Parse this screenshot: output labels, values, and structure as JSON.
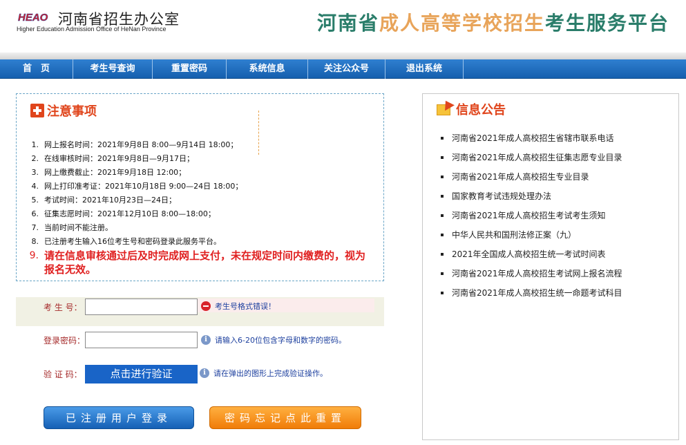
{
  "header": {
    "logo_mark": "HEAO",
    "logo_cn": "河南省招生办公室",
    "logo_en": "Higher Education Admission Office of HeNan Province",
    "title_part1": "河南省",
    "title_part2": "成人高等学校招生",
    "title_part3": "考生服务平台",
    "colors": {
      "green": "#2a7d6a",
      "orange": "#e8a45a"
    }
  },
  "nav": {
    "items": [
      {
        "label": "首　页"
      },
      {
        "label": "考生号查询"
      },
      {
        "label": "重置密码"
      },
      {
        "label": "系统信息"
      },
      {
        "label": "关注公众号"
      },
      {
        "label": "退出系统"
      }
    ]
  },
  "notice": {
    "title": "注意事项",
    "items": [
      {
        "num": "1.",
        "text": "网上报名时间：2021年9月8日 8:00—9月14日 18:00；"
      },
      {
        "num": "2.",
        "text": "在线审核时间：2021年9月8日—9月17日；"
      },
      {
        "num": "3.",
        "text": "网上缴费截止：2021年9月18日 12:00；"
      },
      {
        "num": "4.",
        "text": "网上打印准考证：2021年10月18日 9:00—24日 18:00；"
      },
      {
        "num": "5.",
        "text": "考试时间：2021年10月23日—24日；"
      },
      {
        "num": "6.",
        "text": "征集志愿时间：2021年12月10日 8:00—18:00；"
      },
      {
        "num": "7.",
        "text": "当前时间不能注册。"
      },
      {
        "num": "8.",
        "text": "已注册考生输入16位考生号和密码登录此服务平台。"
      }
    ],
    "warning": {
      "num": "9.",
      "text": "请在信息审核通过后及时完成网上支付，未在规定时间内缴费的，视为报名无效。"
    }
  },
  "form": {
    "exam_id_label": "考 生 号：",
    "exam_id_value": "",
    "exam_id_error": "考生号格式错误！",
    "password_label": "登录密码：",
    "password_value": "",
    "password_hint": "请输入6-20位包含字母和数字的密码。",
    "verify_label": "验 证 码：",
    "verify_button": "点击进行验证",
    "verify_hint": "请在弹出的图形上完成验证操作。",
    "login_button": "已注册用户登录",
    "reset_button": "密码忘记点此重置"
  },
  "announcements": {
    "title": "信息公告",
    "items": [
      "河南省2021年成人高校招生省辖市联系电话",
      "河南省2021年成人高校招生征集志愿专业目录",
      "河南省2021年成人高校招生专业目录",
      "国家教育考试违规处理办法",
      "河南省2021年成人高校招生考试考生须知",
      "中华人民共和国刑法修正案（九）",
      "2021年全国成人高校招生统一考试时间表",
      "河南省2021年成人高校招生考试网上报名流程",
      "河南省2021年成人高校招生统一命题考试科目"
    ]
  }
}
